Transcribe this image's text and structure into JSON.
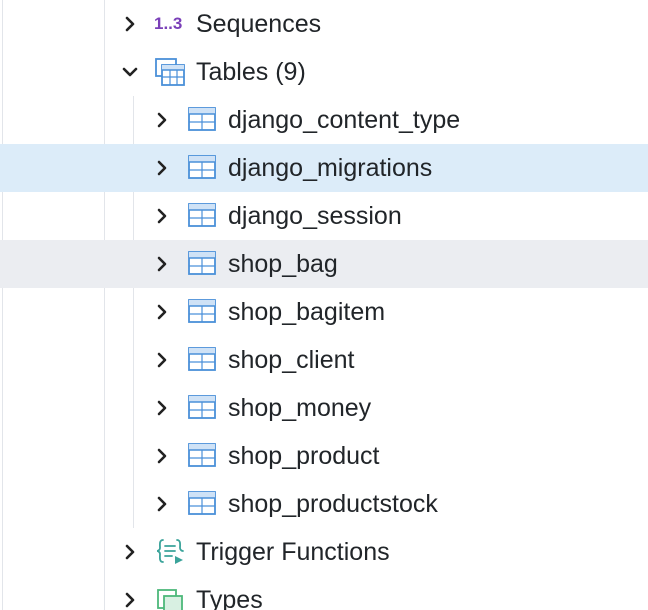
{
  "tree": {
    "sequences": {
      "label": "Sequences",
      "icon": "sequences-icon",
      "icon_text": "1..3",
      "expanded": false
    },
    "tables": {
      "label": "Tables (9)",
      "icon": "tables-icon",
      "expanded": true,
      "items": [
        {
          "label": "django_content_type",
          "icon": "table-icon",
          "state": "normal"
        },
        {
          "label": "django_migrations",
          "icon": "table-icon",
          "state": "selected"
        },
        {
          "label": "django_session",
          "icon": "table-icon",
          "state": "normal"
        },
        {
          "label": "shop_bag",
          "icon": "table-icon",
          "state": "hovered"
        },
        {
          "label": "shop_bagitem",
          "icon": "table-icon",
          "state": "normal"
        },
        {
          "label": "shop_client",
          "icon": "table-icon",
          "state": "normal"
        },
        {
          "label": "shop_money",
          "icon": "table-icon",
          "state": "normal"
        },
        {
          "label": "shop_product",
          "icon": "table-icon",
          "state": "normal"
        },
        {
          "label": "shop_productstock",
          "icon": "table-icon",
          "state": "normal"
        }
      ]
    },
    "trigger_functions": {
      "label": "Trigger Functions",
      "icon": "trigger-functions-icon",
      "expanded": false
    },
    "types": {
      "label": "Types",
      "icon": "types-icon",
      "expanded": false
    }
  },
  "colors": {
    "selected_row": "#dcecf9",
    "hovered_row": "#ebedf1",
    "table_icon": "#4a90d9",
    "sequence_icon": "#7a3fb8",
    "trigger_icon": "#3aa39a",
    "types_icon": "#4cb87a"
  }
}
